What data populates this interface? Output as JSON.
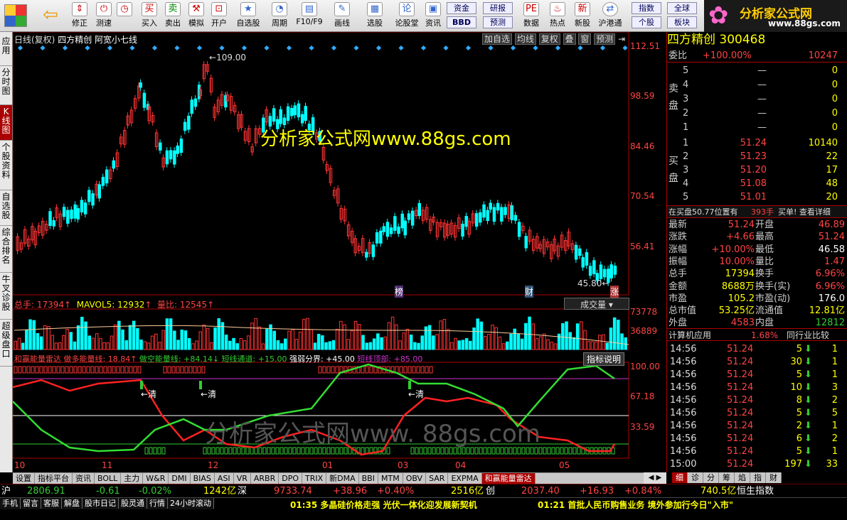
{
  "toolbar": {
    "items": [
      "买入",
      "卖出",
      "模拟",
      "开户",
      "自选股",
      "周期",
      "F10/F9",
      "画线",
      "选股",
      "论股堂",
      "资讯",
      "数据",
      "热点",
      "新股",
      "沪港通"
    ],
    "left": [
      "修正",
      "测速"
    ],
    "small": [
      "资金",
      "研报",
      "BBD",
      "预测",
      "指数",
      "全球",
      "个股",
      "板块"
    ],
    "logo": "分析家公式网",
    "logo_url": "www.88gs.com"
  },
  "leftnav": [
    "应用",
    "分时图",
    "K线图",
    "个股资料",
    "自选股",
    "综合排名",
    "牛叉诊股",
    "超级盘口"
  ],
  "chart": {
    "title": "日线(复权)",
    "name": "四方精创",
    "formula": "阿宽小七线",
    "buttons": [
      "加自选",
      "均线",
      "复权",
      "叠",
      "窗",
      "预测"
    ],
    "price_ticks": [
      "112.51",
      "98.59",
      "84.46",
      "70.54",
      "56.41"
    ],
    "high_label": "109.00",
    "low_label": "45.80",
    "watermark": "分析家公式网www.88gs.com",
    "watermark2": "分析家公式网www. 88gs.com",
    "markers": [
      "榜",
      "财",
      "涨"
    ]
  },
  "volume": {
    "legend": "总手: 17394",
    "mavol": "MAVOL5: 12932",
    "ratio": "量比: 12545",
    "ticks": [
      "73778",
      "36889"
    ],
    "dropdown": "成交量"
  },
  "indicator": {
    "name": "和赢能量雷达",
    "l1": "做多能量线: 18.84",
    "l2": "做空能量线: +84.14",
    "l3": "短线通道: +15.00",
    "l4": "强弱分界: +45.00",
    "l5": "短线顶部: +85.00",
    "button": "指标说明",
    "ticks": [
      "100.00",
      "67.18",
      "33.59"
    ],
    "clear": "清"
  },
  "xaxis": [
    "10",
    "11",
    "12",
    "01",
    "03",
    "04",
    "05"
  ],
  "tabs": [
    "设置",
    "指标平台",
    "资讯",
    "BOLL",
    "主力",
    "W&R",
    "DMI",
    "BIAS",
    "ASI",
    "VR",
    "ARBR",
    "DPO",
    "TRIX",
    "新DMA",
    "BBI",
    "MTM",
    "OBV",
    "SAR",
    "EXPMA",
    "和赢能量雷达"
  ],
  "right": {
    "title": "四方精创 300468",
    "weibi_label": "委比",
    "weibi": "+100.00%",
    "weicha": "10247",
    "sell_label": "卖盘",
    "buy_label": "买盘",
    "sell": [
      [
        "5",
        "—",
        "0"
      ],
      [
        "4",
        "—",
        "0"
      ],
      [
        "3",
        "—",
        "0"
      ],
      [
        "2",
        "—",
        "0"
      ],
      [
        "1",
        "—",
        "0"
      ]
    ],
    "buy": [
      [
        "1",
        "51.24",
        "10140"
      ],
      [
        "2",
        "51.23",
        "22"
      ],
      [
        "3",
        "51.20",
        "17"
      ],
      [
        "4",
        "51.08",
        "48"
      ],
      [
        "5",
        "51.01",
        "20"
      ]
    ],
    "inbuy": "在买盘50.77位置有",
    "inbuy_qty": "393手",
    "inbuy_tail": "买单! 查看详细",
    "stats": [
      [
        "最新",
        "51.24",
        "开盘",
        "46.89"
      ],
      [
        "涨跌",
        "+4.66",
        "最高",
        "51.24"
      ],
      [
        "涨幅",
        "+10.00%",
        "最低",
        "46.58"
      ],
      [
        "振幅",
        "10.00%",
        "量比",
        "1.47"
      ],
      [
        "总手",
        "17394",
        "换手",
        "6.96%"
      ],
      [
        "金额",
        "8688万",
        "换手(实)",
        "6.96%"
      ],
      [
        "市盈",
        "105.2",
        "市盈(动)",
        "176.0"
      ],
      [
        "总市值",
        "53.25亿",
        "流通值",
        "12.81亿"
      ],
      [
        "外盘",
        "4583",
        "内盘",
        "12812"
      ]
    ],
    "industry": "计算机应用",
    "ind_pct": "1.68%",
    "compare": "同行业比较",
    "ticks": [
      [
        "14:56",
        "51.24",
        "5",
        "1"
      ],
      [
        "14:56",
        "51.24",
        "30",
        "1"
      ],
      [
        "14:56",
        "51.24",
        "5",
        "1"
      ],
      [
        "14:56",
        "51.24",
        "10",
        "3"
      ],
      [
        "14:56",
        "51.24",
        "8",
        "2"
      ],
      [
        "14:56",
        "51.24",
        "5",
        "5"
      ],
      [
        "14:56",
        "51.24",
        "2",
        "1"
      ],
      [
        "14:56",
        "51.24",
        "6",
        "2"
      ],
      [
        "14:56",
        "51.24",
        "5",
        "1"
      ],
      [
        "15:00",
        "51.24",
        "197",
        "33"
      ]
    ],
    "tabs": [
      "细",
      "诊",
      "分",
      "筹",
      "焰",
      "指",
      "财"
    ]
  },
  "index": {
    "sh": "沪",
    "sh_v": "2806.91",
    "sh_c": "-0.61",
    "sh_p": "-0.02%",
    "sh_a": "1242亿",
    "sz": "深",
    "sz_v": "9733.74",
    "sz_c": "+38.96",
    "sz_p": "+0.40%",
    "sz_a": "2516亿",
    "cy": "创",
    "cy_v": "2037.40",
    "cy_c": "+16.93",
    "cy_p": "+0.84%",
    "cy_a": "740.5亿",
    "hs": "恒生指数"
  },
  "status": {
    "items": [
      "手机",
      "留言",
      "客服",
      "解盘",
      "股市日记",
      "股灵通",
      "行情",
      "24小时滚动"
    ],
    "news1_t": "01:35",
    "news1": "多晶硅价格走强 光伏一体化迎发展新契机",
    "news2_t": "01:21",
    "news2": "首批人民币购售业务 境外参加行今日\"入市\""
  }
}
